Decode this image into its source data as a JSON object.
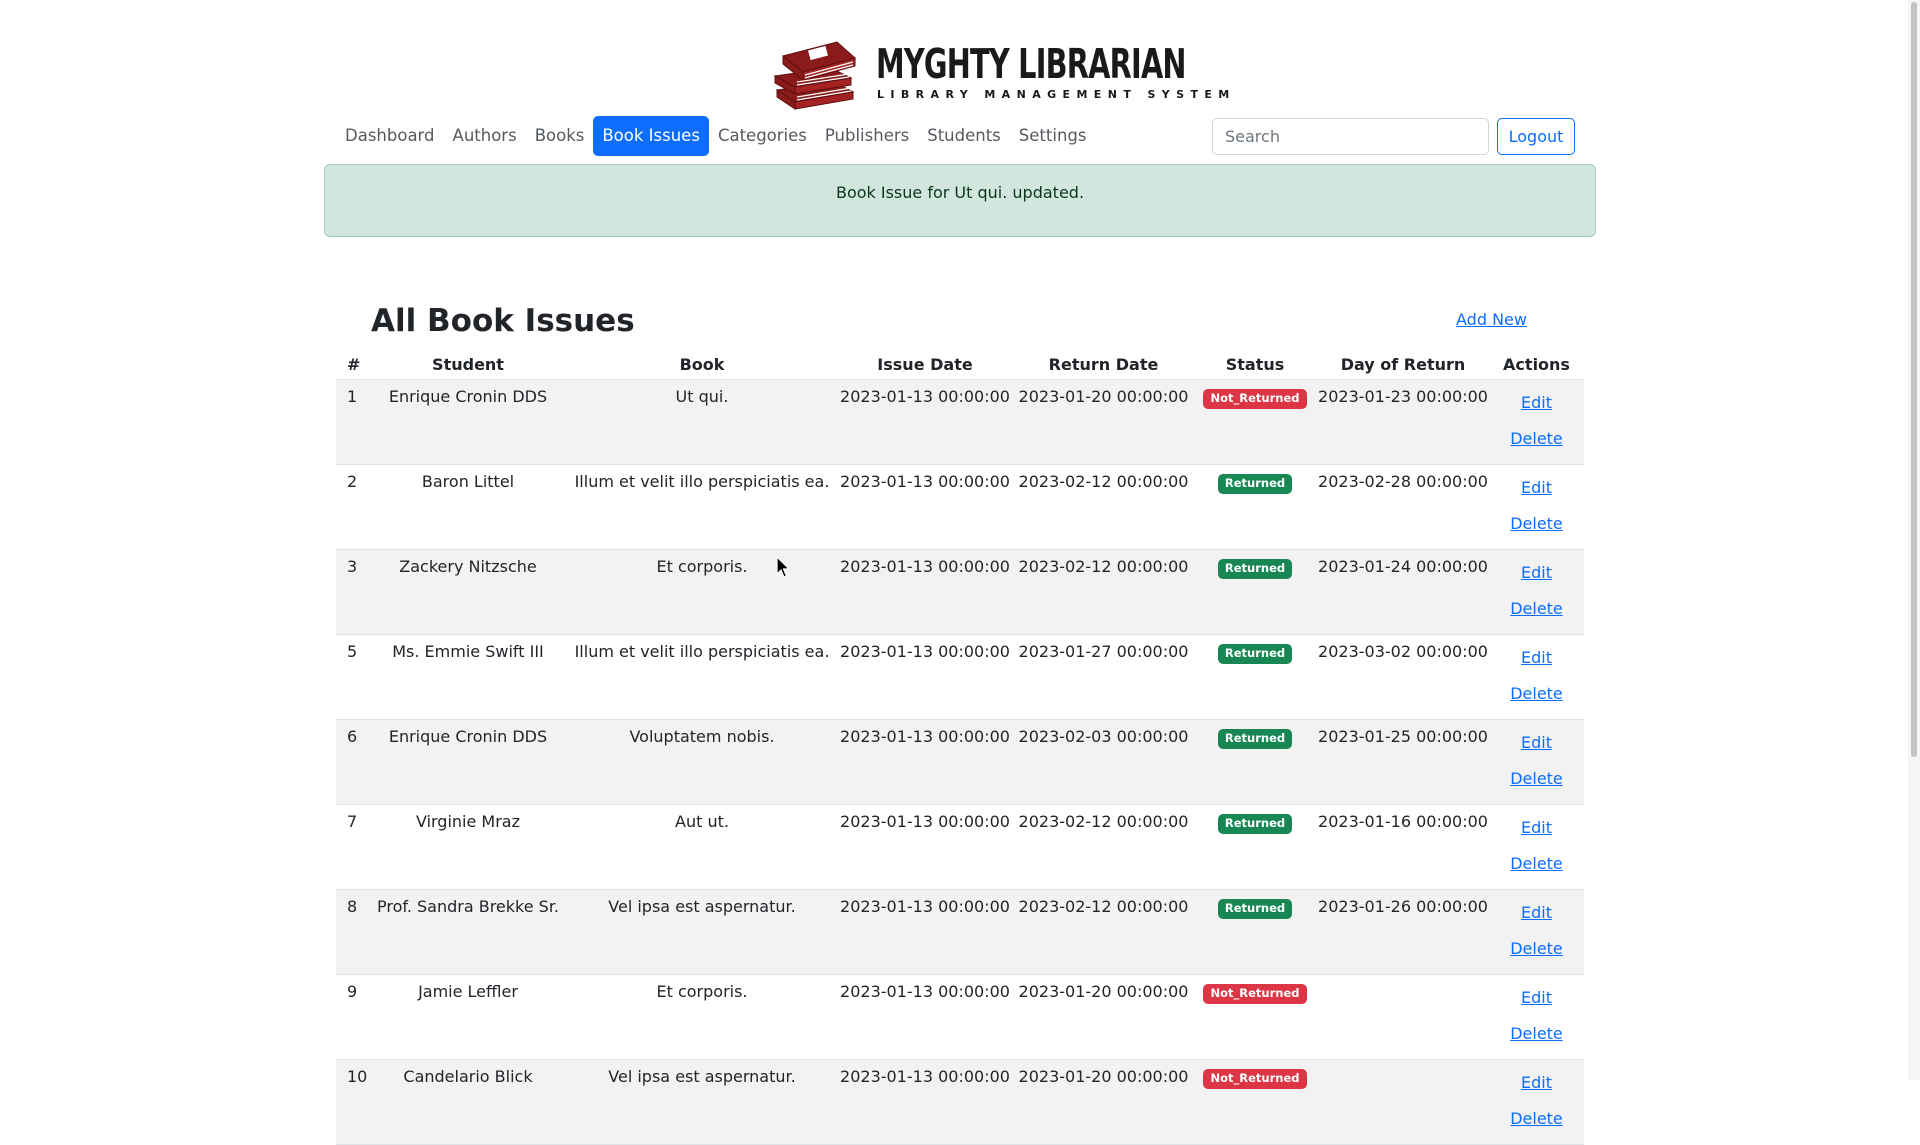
{
  "brand": {
    "title": "Myghty Librarian",
    "subtitle": "LIBRARY MANAGEMENT SYSTEM",
    "logo_icon": "books-stack-icon",
    "logo_color": "#8b1a1a"
  },
  "nav": {
    "items": [
      {
        "label": "Dashboard"
      },
      {
        "label": "Authors"
      },
      {
        "label": "Books"
      },
      {
        "label": "Book Issues",
        "active": true
      },
      {
        "label": "Categories"
      },
      {
        "label": "Publishers"
      },
      {
        "label": "Students"
      },
      {
        "label": "Settings"
      }
    ],
    "search_placeholder": "Search",
    "logout_label": "Logout"
  },
  "alert": {
    "message": "Book Issue for Ut qui. updated."
  },
  "main": {
    "title": "All Book Issues",
    "add_new_label": "Add New",
    "columns": [
      "#",
      "Student",
      "Book",
      "Issue Date",
      "Return Date",
      "Status",
      "Day of Return",
      "Actions"
    ],
    "rows": [
      {
        "id": "1",
        "student": "Enrique Cronin DDS",
        "book": "Ut qui.",
        "issue_date": "2023-01-13 00:00:00",
        "return_date": "2023-01-20 00:00:00",
        "status": "Not_Returned",
        "day_of_return": "2023-01-23 00:00:00"
      },
      {
        "id": "2",
        "student": "Baron Littel",
        "book": "Illum et velit illo perspiciatis ea.",
        "issue_date": "2023-01-13 00:00:00",
        "return_date": "2023-02-12 00:00:00",
        "status": "Returned",
        "day_of_return": "2023-02-28 00:00:00"
      },
      {
        "id": "3",
        "student": "Zackery Nitzsche",
        "book": "Et corporis.",
        "issue_date": "2023-01-13 00:00:00",
        "return_date": "2023-02-12 00:00:00",
        "status": "Returned",
        "day_of_return": "2023-01-24 00:00:00"
      },
      {
        "id": "5",
        "student": "Ms. Emmie Swift III",
        "book": "Illum et velit illo perspiciatis ea.",
        "issue_date": "2023-01-13 00:00:00",
        "return_date": "2023-01-27 00:00:00",
        "status": "Returned",
        "day_of_return": "2023-03-02 00:00:00"
      },
      {
        "id": "6",
        "student": "Enrique Cronin DDS",
        "book": "Voluptatem nobis.",
        "issue_date": "2023-01-13 00:00:00",
        "return_date": "2023-02-03 00:00:00",
        "status": "Returned",
        "day_of_return": "2023-01-25 00:00:00"
      },
      {
        "id": "7",
        "student": "Virginie Mraz",
        "book": "Aut ut.",
        "issue_date": "2023-01-13 00:00:00",
        "return_date": "2023-02-12 00:00:00",
        "status": "Returned",
        "day_of_return": "2023-01-16 00:00:00"
      },
      {
        "id": "8",
        "student": "Prof. Sandra Brekke Sr.",
        "book": "Vel ipsa est aspernatur.",
        "issue_date": "2023-01-13 00:00:00",
        "return_date": "2023-02-12 00:00:00",
        "status": "Returned",
        "day_of_return": "2023-01-26 00:00:00"
      },
      {
        "id": "9",
        "student": "Jamie Leffler",
        "book": "Et corporis.",
        "issue_date": "2023-01-13 00:00:00",
        "return_date": "2023-01-20 00:00:00",
        "status": "Not_Returned",
        "day_of_return": ""
      },
      {
        "id": "10",
        "student": "Candelario Blick",
        "book": "Vel ipsa est aspernatur.",
        "issue_date": "2023-01-13 00:00:00",
        "return_date": "2023-01-20 00:00:00",
        "status": "Not_Returned",
        "day_of_return": ""
      }
    ],
    "edit_label": "Edit",
    "delete_label": "Delete"
  },
  "colors": {
    "primary": "#0d6efd",
    "success": "#198754",
    "danger": "#dc3545",
    "alert_bg": "#d1e7dd",
    "alert_text": "#0a3622"
  }
}
